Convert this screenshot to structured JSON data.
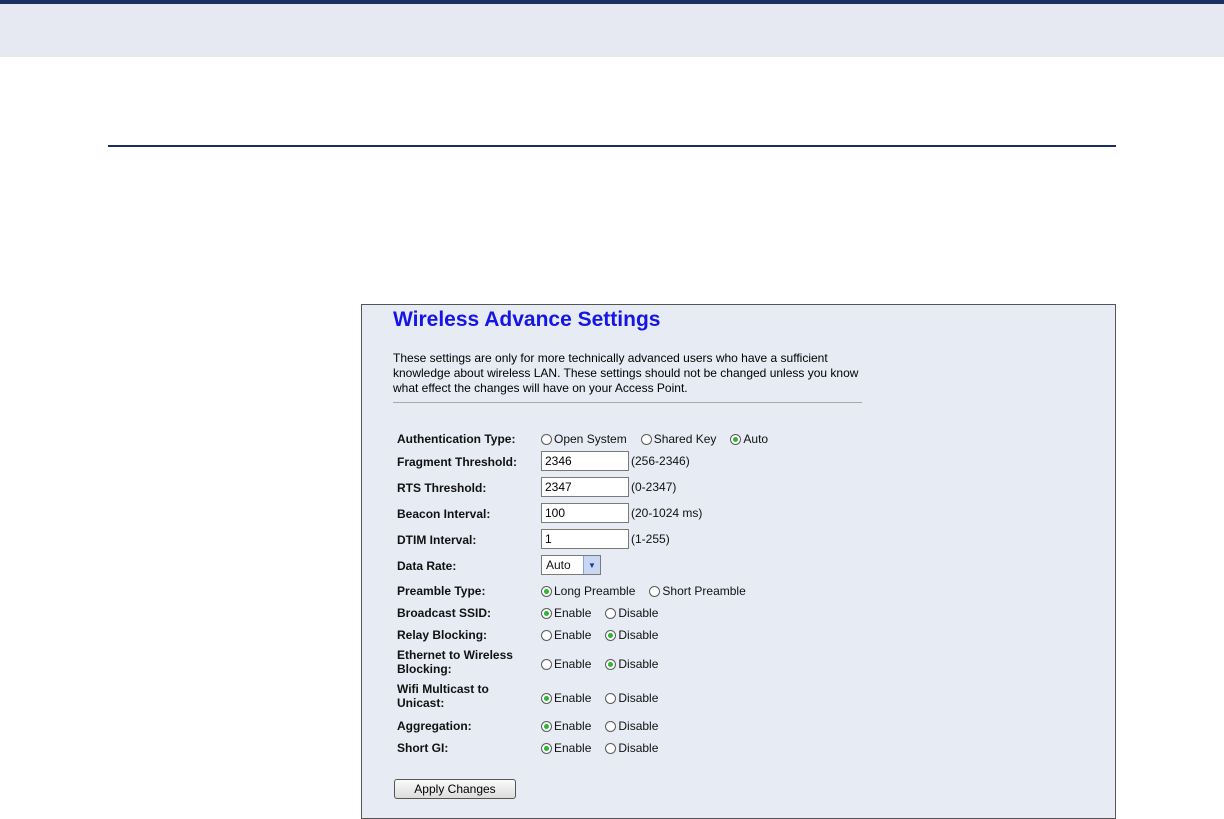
{
  "panel": {
    "title": "Wireless Advance Settings",
    "description": "These settings are only for more technically advanced users who have a sufficient knowledge about wireless LAN. These settings should not be changed unless you know what effect the changes will have on your Access Point."
  },
  "form": {
    "authentication_type": {
      "label": "Authentication Type:",
      "options": [
        {
          "label": "Open System",
          "checked": false
        },
        {
          "label": "Shared Key",
          "checked": false
        },
        {
          "label": "Auto",
          "checked": true
        }
      ]
    },
    "fragment_threshold": {
      "label": "Fragment Threshold:",
      "value": "2346",
      "range": "(256-2346)"
    },
    "rts_threshold": {
      "label": "RTS Threshold:",
      "value": "2347",
      "range": "(0-2347)"
    },
    "beacon_interval": {
      "label": "Beacon Interval:",
      "value": "100",
      "range": "(20-1024 ms)"
    },
    "dtim_interval": {
      "label": "DTIM Interval:",
      "value": "1",
      "range": "(1-255)"
    },
    "data_rate": {
      "label": "Data Rate:",
      "value": "Auto"
    },
    "preamble_type": {
      "label": "Preamble Type:",
      "options": [
        {
          "label": "Long Preamble",
          "checked": true
        },
        {
          "label": "Short Preamble",
          "checked": false
        }
      ]
    },
    "broadcast_ssid": {
      "label": "Broadcast SSID:",
      "options": [
        {
          "label": "Enable",
          "checked": true
        },
        {
          "label": "Disable",
          "checked": false
        }
      ]
    },
    "relay_blocking": {
      "label": "Relay Blocking:",
      "options": [
        {
          "label": "Enable",
          "checked": false
        },
        {
          "label": "Disable",
          "checked": true
        }
      ]
    },
    "ethernet_wireless_blocking": {
      "label": "Ethernet to Wireless Blocking:",
      "options": [
        {
          "label": "Enable",
          "checked": false
        },
        {
          "label": "Disable",
          "checked": true
        }
      ]
    },
    "wifi_multicast_unicast": {
      "label": "Wifi Multicast to Unicast:",
      "options": [
        {
          "label": "Enable",
          "checked": true
        },
        {
          "label": "Disable",
          "checked": false
        }
      ]
    },
    "aggregation": {
      "label": "Aggregation:",
      "options": [
        {
          "label": "Enable",
          "checked": true
        },
        {
          "label": "Disable",
          "checked": false
        }
      ]
    },
    "short_gi": {
      "label": "Short GI:",
      "options": [
        {
          "label": "Enable",
          "checked": true
        },
        {
          "label": "Disable",
          "checked": false
        }
      ]
    }
  },
  "buttons": {
    "apply_label": "Apply Changes"
  },
  "icons": {
    "select_arrow": "chevron-down-icon"
  },
  "colors": {
    "title": "#1515e6",
    "radio_checked": "#2fb62f",
    "panel_bg": "#e7ebf3",
    "header_bar": "#1c2f5e"
  }
}
